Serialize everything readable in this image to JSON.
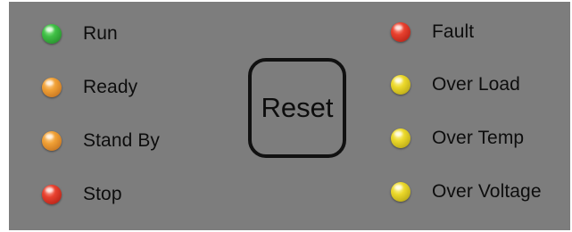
{
  "colors": {
    "panel_background": "#7d7d7d",
    "led_green": "#2fa336",
    "led_orange": "#e08a1e",
    "led_red": "#d62a1e",
    "led_yellow": "#e3d21c"
  },
  "left_indicators": [
    {
      "label": "Run",
      "led_color": "green",
      "icon": "led-green-icon"
    },
    {
      "label": "Ready",
      "led_color": "orange",
      "icon": "led-orange-icon"
    },
    {
      "label": "Stand By",
      "led_color": "orange",
      "icon": "led-orange-icon"
    },
    {
      "label": "Stop",
      "led_color": "red",
      "icon": "led-red-icon"
    }
  ],
  "right_indicators": [
    {
      "label": "Fault",
      "led_color": "red",
      "icon": "led-red-icon"
    },
    {
      "label": "Over Load",
      "led_color": "yellow",
      "icon": "led-yellow-icon"
    },
    {
      "label": "Over Temp",
      "led_color": "yellow",
      "icon": "led-yellow-icon"
    },
    {
      "label": "Over Voltage",
      "led_color": "yellow",
      "icon": "led-yellow-icon"
    }
  ],
  "reset_button": {
    "label": "Reset"
  }
}
